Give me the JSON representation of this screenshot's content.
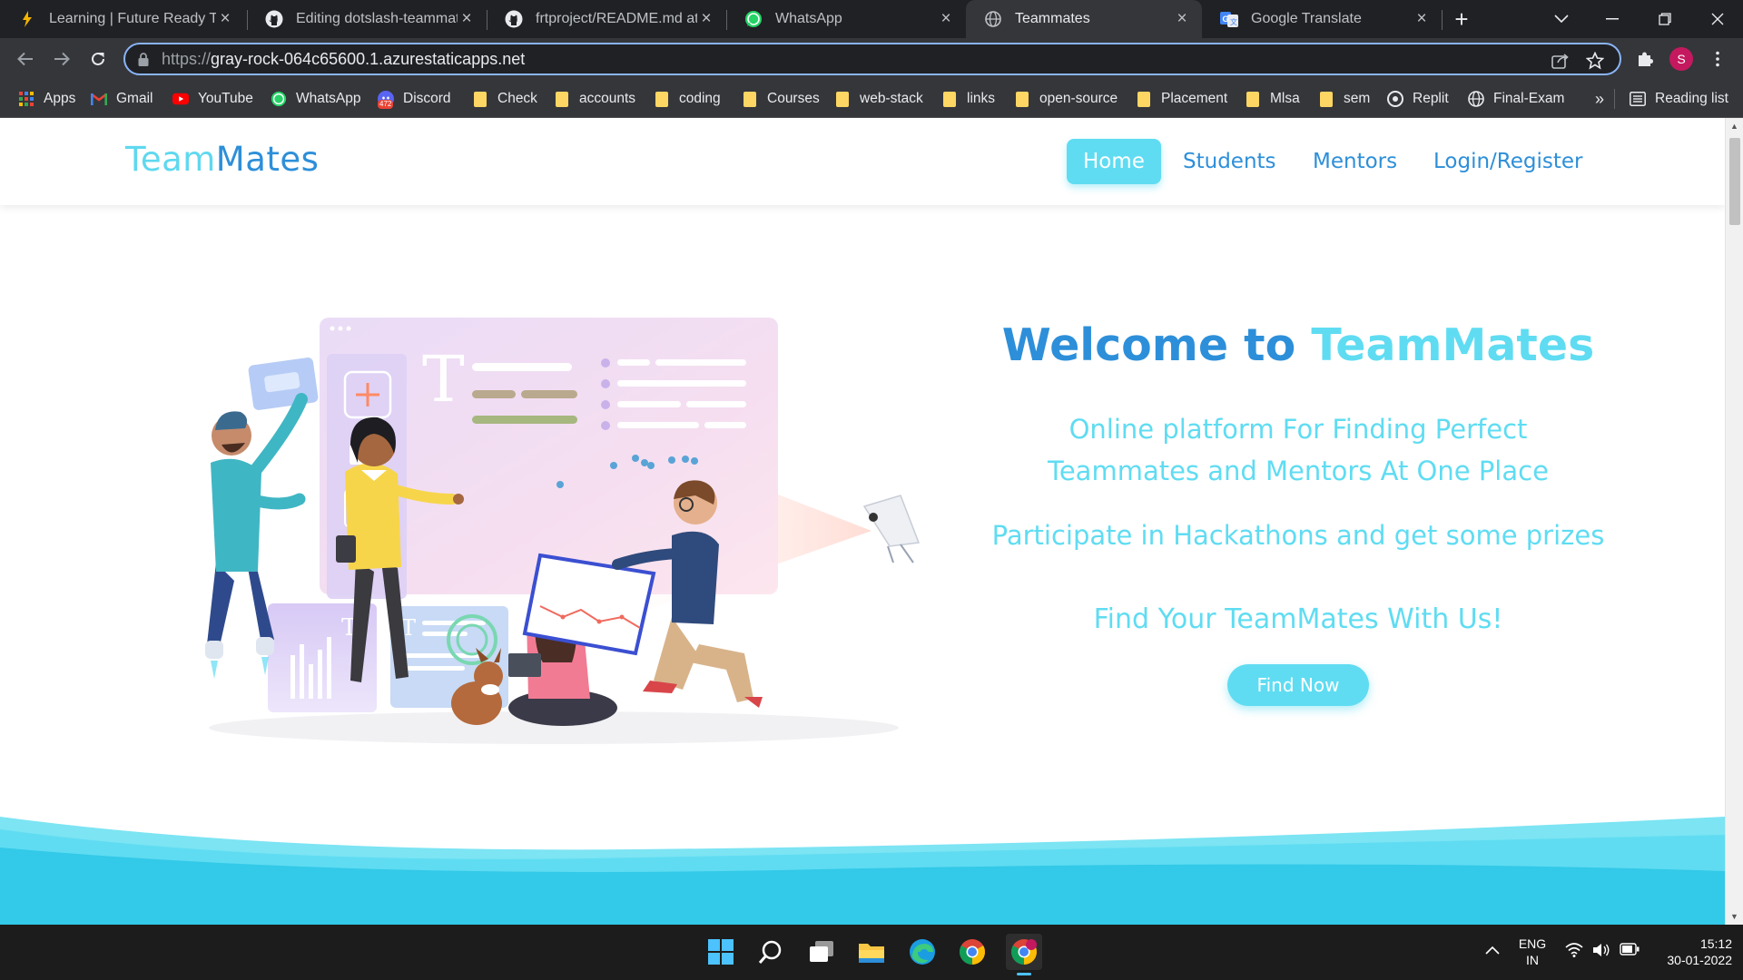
{
  "tabs": [
    {
      "title": "Learning | Future Ready Talent",
      "icon": "lightning-favicon-icon"
    },
    {
      "title": "Editing dotslash-teammates",
      "icon": "github-icon"
    },
    {
      "title": "frtproject/README.md at main",
      "icon": "github-icon"
    },
    {
      "title": "WhatsApp",
      "icon": "whatsapp-icon"
    },
    {
      "title": "Teammates",
      "icon": "globe-icon",
      "active": true
    },
    {
      "title": "Google Translate",
      "icon": "google-translate-icon"
    }
  ],
  "address_bar": {
    "scheme": "https://",
    "host": "gray-rock-064c65600.1.azurestaticapps.net"
  },
  "profile_initial": "S",
  "bookmarks": [
    {
      "label": "Apps",
      "icon": "apps-grid-icon"
    },
    {
      "label": "Gmail",
      "icon": "gmail-icon"
    },
    {
      "label": "YouTube",
      "icon": "youtube-icon"
    },
    {
      "label": "WhatsApp",
      "icon": "whatsapp-icon"
    },
    {
      "label": "Discord",
      "icon": "discord-icon",
      "badge": "472"
    },
    {
      "label": "Check",
      "icon": "folder-icon"
    },
    {
      "label": "accounts",
      "icon": "folder-icon"
    },
    {
      "label": "coding",
      "icon": "folder-icon"
    },
    {
      "label": "Courses",
      "icon": "folder-icon"
    },
    {
      "label": "web-stack",
      "icon": "folder-icon"
    },
    {
      "label": "links",
      "icon": "folder-icon"
    },
    {
      "label": "open-source",
      "icon": "folder-icon"
    },
    {
      "label": "Placement",
      "icon": "folder-icon"
    },
    {
      "label": "Mlsa",
      "icon": "folder-icon"
    },
    {
      "label": "sem",
      "icon": "folder-icon"
    },
    {
      "label": "Replit",
      "icon": "replit-icon"
    },
    {
      "label": "Final-Exam",
      "icon": "globe-icon"
    }
  ],
  "bookmarks_overflow": "»",
  "reading_list": "Reading list",
  "site": {
    "brand_part1": "Team",
    "brand_part2": "Mates",
    "nav": [
      "Home",
      "Students",
      "Mentors",
      "Login/Register"
    ],
    "active_nav": "Home",
    "welcome_prefix": "Welcome to",
    "welcome_brand": "TeamMates",
    "tagline_line1": "Online platform For Finding Perfect",
    "tagline_line2": "Teammates and Mentors At One Place",
    "participate": "Participate in Hackathons and get some prizes",
    "find_heading": "Find Your TeamMates With Us!",
    "find_button": "Find Now"
  },
  "colors": {
    "brand_blue": "#2d8fd9",
    "brand_cyan": "#5fdcf2",
    "wave": "#33c9e8"
  },
  "taskbar": {
    "apps": [
      "windows-start-icon",
      "search-icon",
      "task-view-icon",
      "file-explorer-icon",
      "edge-icon",
      "chrome-icon",
      "chrome-profile-icon"
    ],
    "language_top": "ENG",
    "language_bottom": "IN",
    "time": "15:12",
    "date": "30-01-2022"
  }
}
